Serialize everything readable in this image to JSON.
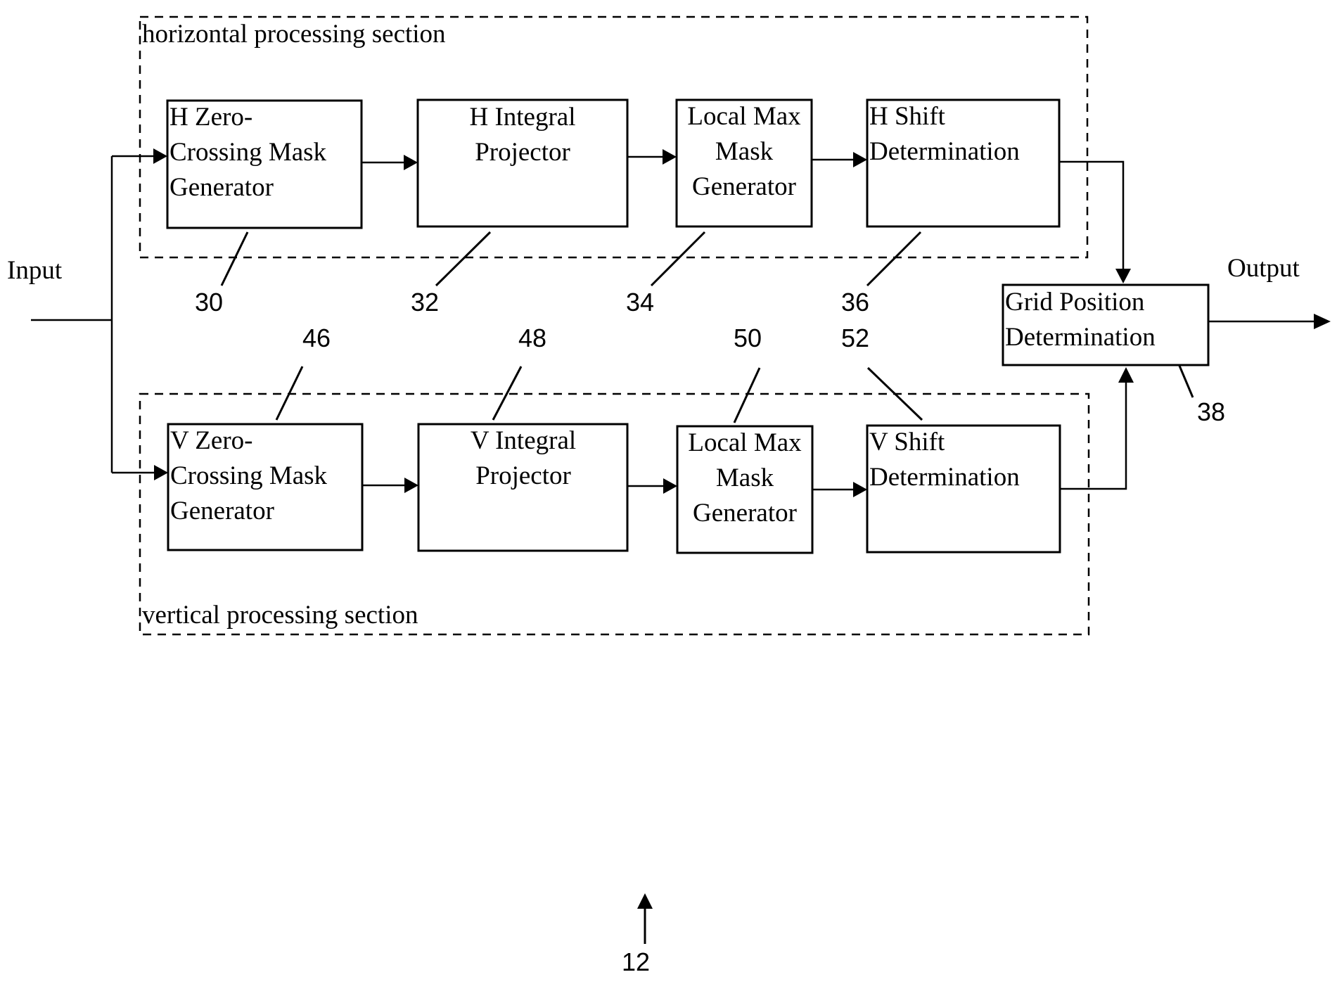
{
  "figure": {
    "figure_ref": "12",
    "input_label": "Input",
    "output_label": "Output"
  },
  "sections": {
    "horizontal": {
      "label": "horizontal processing section"
    },
    "vertical": {
      "label": "vertical processing section"
    }
  },
  "blocks": {
    "h_zero": {
      "lines": [
        "H Zero-",
        "Crossing Mask",
        "Generator"
      ],
      "ref": "30"
    },
    "h_integral": {
      "lines": [
        "H Integral",
        "Projector"
      ],
      "ref": "32"
    },
    "h_localmax": {
      "lines": [
        "Local Max",
        "Mask",
        "Generator"
      ],
      "ref": "34"
    },
    "h_shift": {
      "lines": [
        "H Shift",
        "Determination"
      ],
      "ref": "36"
    },
    "grid": {
      "lines": [
        "Grid Position",
        "Determination"
      ],
      "ref": "38"
    },
    "v_zero": {
      "lines": [
        "V Zero-",
        "Crossing Mask",
        "Generator"
      ],
      "ref": "46"
    },
    "v_integral": {
      "lines": [
        "V Integral",
        "Projector"
      ],
      "ref": "48"
    },
    "v_localmax": {
      "lines": [
        "Local Max",
        "Mask",
        "Generator"
      ],
      "ref": "50"
    },
    "v_shift": {
      "lines": [
        "V Shift",
        "Determination"
      ],
      "ref": "52"
    }
  }
}
